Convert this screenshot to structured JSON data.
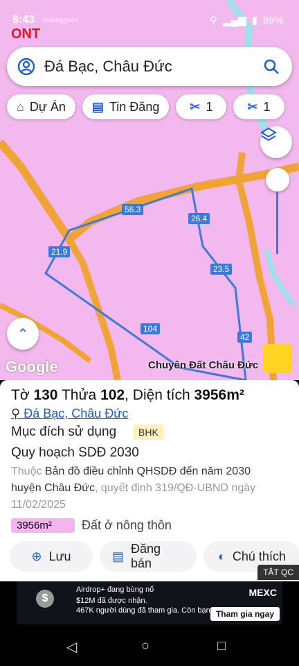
{
  "status": {
    "time": "8:43",
    "battery": "89%",
    "watermark": "©donggson",
    "ont_label": "ONT"
  },
  "search": {
    "query": "Đá Bạc, Châu Đức"
  },
  "chips": [
    {
      "label": "Dự Án",
      "icon": "house-icon"
    },
    {
      "label": "Tin Đăng",
      "icon": "listing-icon"
    },
    {
      "label": "1",
      "icon": "scissors-icon"
    },
    {
      "label": "1",
      "icon": "scissors-icon"
    }
  ],
  "map": {
    "segment_labels": [
      "56.3",
      "26.4",
      "21.9",
      "23.5",
      "104",
      "42"
    ],
    "google": "Google",
    "brand": "Chuyên Đất Châu Đức",
    "colors": {
      "land": "#f3b9ef",
      "road": "#f0a437",
      "water": "#9fe0e9",
      "boundary": "#3d7ad8"
    }
  },
  "parcel": {
    "title_prefix_to": "Tờ",
    "to": "130",
    "thua_label": "Thửa",
    "thua": "102",
    "area_label": ", Diện tích",
    "area": "3956m²",
    "location_commune": "Đá Bạc",
    "location_district": "Châu Đức",
    "usage_label": "Mục đích sử dụng",
    "usage_code": "BHK",
    "plan_title": "Quy hoạch SDĐ 2030",
    "desc_prefix": "Thuộc",
    "desc_plan": "Bản đồ điều chỉnh QHSDĐ đến năm 2030 huyện Châu Đức",
    "desc_decision": ", quyết định 319/QĐ-UBND ngày 11/02/2025",
    "area_chip": "3956m²",
    "area_type": "Đất ở nông thôn"
  },
  "actions": [
    {
      "label": "Lưu",
      "icon": "add-doc-icon"
    },
    {
      "label": "Đăng bán",
      "icon": "newspaper-icon"
    },
    {
      "label": "Chú thích",
      "icon": "contrast-icon"
    }
  ],
  "ad": {
    "close_label": "TẮT QC",
    "line1": "Airdrop+ đang bùng nổ",
    "line2": "$12M đã được nhận.",
    "line3": "467K người dùng đã tham gia. Còn bạn?",
    "brand": "MEXC",
    "cta": "Tham gia ngay"
  }
}
